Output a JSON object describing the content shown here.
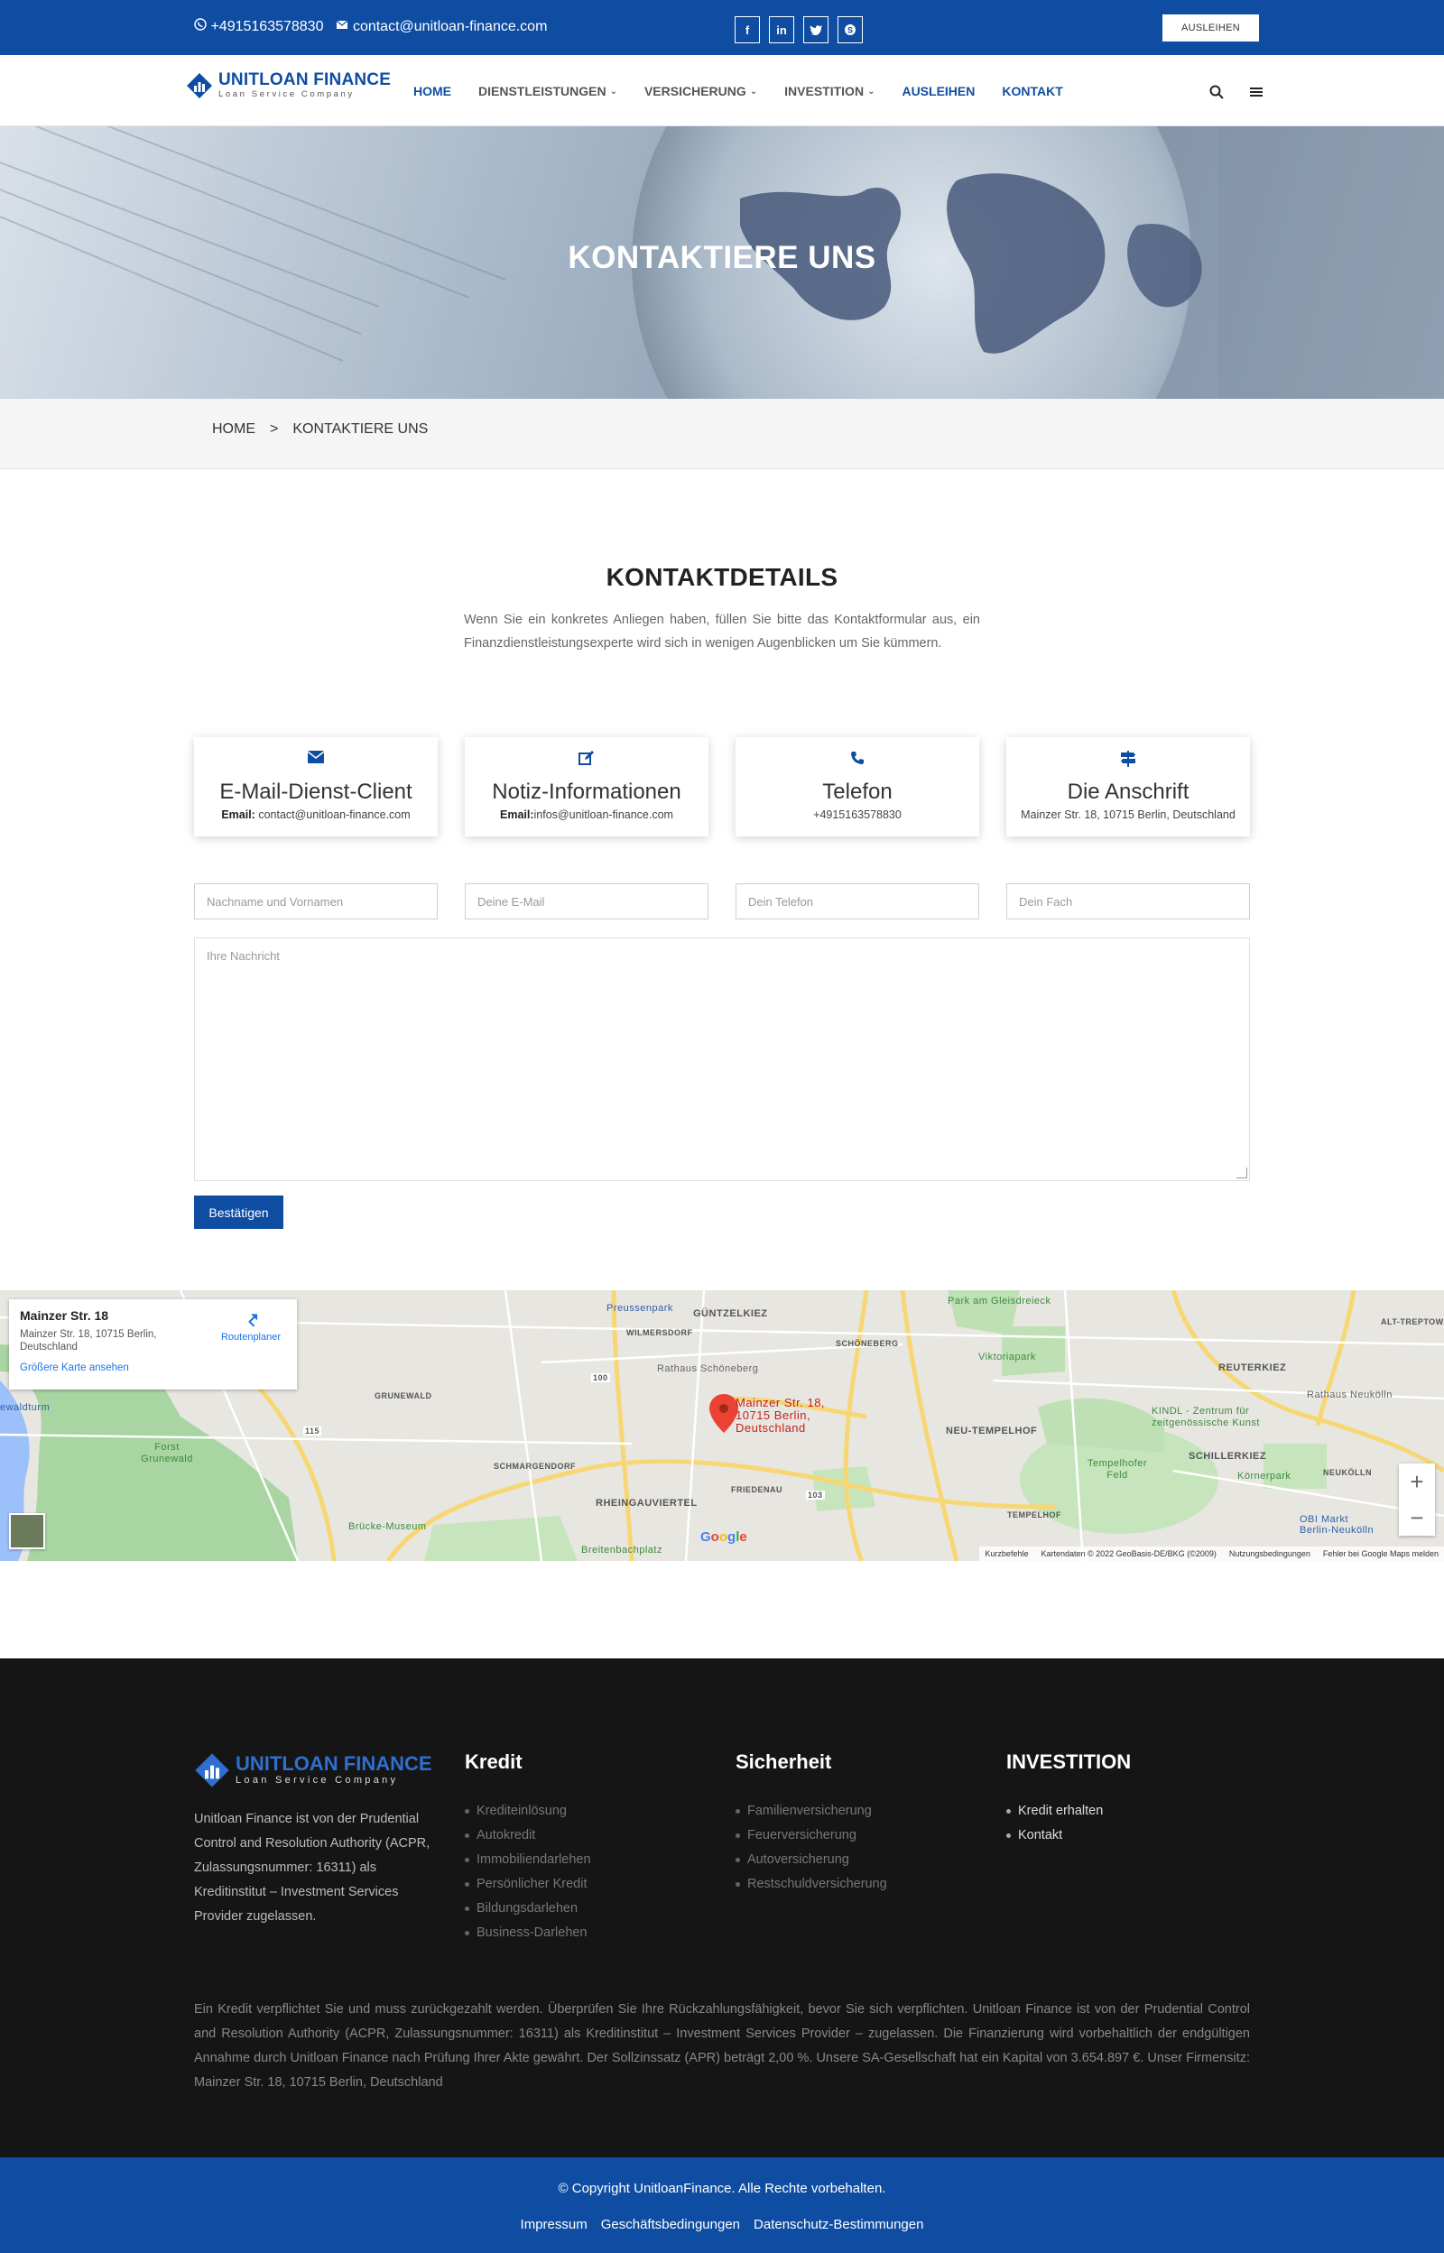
{
  "topbar": {
    "phone": "+4915163578830",
    "email": "contact@unitloan-finance.com",
    "socials": [
      "f",
      "in",
      "t",
      "s"
    ],
    "cta_label": "AUSLEIHEN"
  },
  "brand": {
    "name": "UNITLOAN FINANCE",
    "tagline": "Loan Service Company",
    "accent": "#0f4da2"
  },
  "nav": {
    "items": [
      {
        "label": "HOME"
      },
      {
        "label": "DIENSTLEISTUNGEN"
      },
      {
        "label": "VERSICHERUNG"
      },
      {
        "label": "INVESTITION"
      },
      {
        "label": "AUSLEIHEN"
      },
      {
        "label": "KONTAKT"
      }
    ]
  },
  "hero": {
    "title": "KONTAKTIERE UNS"
  },
  "breadcrumb": {
    "home": "HOME",
    "sep": ">",
    "current": "KONTAKTIERE UNS"
  },
  "contact": {
    "title": "KONTAKTDETAILS",
    "intro": "Wenn Sie ein konkretes Anliegen haben, füllen Sie bitte das Kontaktformular aus, ein Finanzdienstleistungsexperte wird sich in wenigen Augenblicken um Sie kümmern.",
    "cards": [
      {
        "icon": "envelope-icon",
        "heading": "E-Mail-Dienst-Client",
        "label": "Email:",
        "value": " contact@unitloan-finance.com"
      },
      {
        "icon": "edit-icon",
        "heading": "Notiz-Informationen",
        "label": "Email:",
        "value": "infos@unitloan-finance.com"
      },
      {
        "icon": "phone-icon",
        "heading": "Telefon",
        "label": "",
        "value": "+4915163578830"
      },
      {
        "icon": "signpost-icon",
        "heading": "Die Anschrift",
        "label": "",
        "value": "Mainzer Str. 18, 10715 Berlin, Deutschland"
      }
    ]
  },
  "form": {
    "name_placeholder": "Nachname und Vornamen",
    "email_placeholder": "Deine E-Mail",
    "phone_placeholder": "Dein Telefon",
    "subject_placeholder": "Dein Fach",
    "message_placeholder": "Ihre Nachricht",
    "submit_label": "Bestätigen"
  },
  "map": {
    "place_name": "Mainzer Str. 18",
    "place_address": "Mainzer Str. 18, 10715 Berlin, Deutschland",
    "larger_map_link": "Größere Karte ansehen",
    "directions_label": "Routenplaner",
    "marker_label": "Mainzer Str. 18, 10715 Berlin, Deutschland",
    "google": "Google",
    "footer_items": [
      "Kurzbefehle",
      "Kartendaten © 2022 GeoBasis-DE/BKG (©2009)",
      "Nutzungsbedingungen",
      "Fehler bei Google Maps melden"
    ],
    "labels": {
      "preussenpark": "Preussenpark",
      "guntzelkiez": "GÜNTZELKIEZ",
      "wilmersdorf": "WILMERSDORF",
      "schoeneberg": "SCHÖNEBERG",
      "park_gleis": "Park am Gleisdreieck",
      "viktoriapark": "Viktoriapark",
      "reuterkiez": "REUTERKIEZ",
      "alt_treptow": "ALT-TREPTOW",
      "grunewald": "GRUNEWALD",
      "rathaus_schoeneberg": "Rathaus Schöneberg",
      "rathaus_neukoelln": "Rathaus Neukölln",
      "kindl": "KINDL - Zentrum für zeitgenössische Kunst",
      "neu_tempelhof": "NEU-TEMPELHOF",
      "schillerkiez": "SCHILLERKIEZ",
      "tempelhofer_feld": "Tempelhofer Feld",
      "koernerpark": "Körnerpark",
      "neukoelln": "NEUKÖLLN",
      "forst_grunewald": "Forst Grunewald",
      "schmargendorf": "SCHMARGENDORF",
      "friedenau": "FRIEDENAU",
      "rheingauviertel": "RHEINGAUVIERTEL",
      "bruecke_museum": "Brücke-Museum",
      "breitenbachplatz": "Breitenbachplatz",
      "tempelhof": "TEMPELHOF",
      "obi": "OBI Markt Berlin-Neukölln",
      "ewaldturm": "ewaldturm",
      "a100": "100",
      "a103": "103",
      "a115": "115"
    }
  },
  "footer": {
    "about": "Unitloan Finance ist von der Prudential Control and Resolution Authority (ACPR, Zulassungsnummer: 16311) als Kreditinstitut – Investment Services Provider zugelassen.",
    "columns": [
      {
        "heading": "Kredit",
        "items": [
          "Krediteinlösung",
          "Autokredit",
          "Immobiliendarlehen",
          "Persönlicher Kredit",
          "Bildungsdarlehen",
          "Business-Darlehen"
        ]
      },
      {
        "heading": "Sicherheit",
        "items": [
          "Familienversicherung",
          "Feuerversicherung",
          "Autoversicherung",
          "Restschuldversicherung"
        ]
      },
      {
        "heading": "INVESTITION",
        "items": [
          "Kredit erhalten",
          "Kontakt"
        ]
      }
    ],
    "notice": "Ein Kredit verpflichtet Sie und muss zurückgezahlt werden. Überprüfen Sie Ihre Rückzahlungsfähigkeit, bevor Sie sich verpflichten. Unitloan Finance ist von der Prudential Control and Resolution Authority (ACPR, Zulassungsnummer: 16311) als Kreditinstitut – Investment Services Provider – zugelassen. Die Finanzierung wird vorbehaltlich der endgültigen Annahme durch Unitloan Finance nach Prüfung Ihrer Akte gewährt. Der Sollzinssatz (APR) beträgt 2,00 %. Unsere SA-Gesellschaft hat ein Kapital von 3.654.897 €. Unser Firmensitz: Mainzer Str. 18, 10715 Berlin, Deutschland",
    "copyright": "© Copyright UnitloanFinance. Alle Rechte vorbehalten.",
    "links": [
      "Impressum",
      "Geschäftsbedingungen",
      "Datenschutz-Bestimmungen"
    ]
  }
}
